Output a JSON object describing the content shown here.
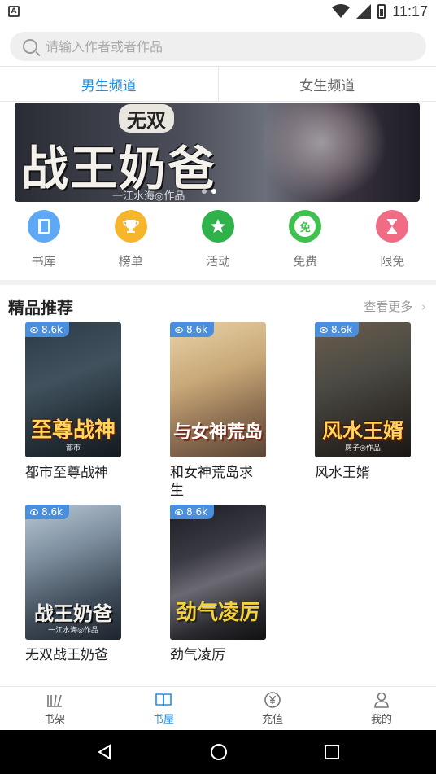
{
  "status_bar": {
    "time": "11:17"
  },
  "search": {
    "placeholder": "请输入作者或者作品"
  },
  "tabs": [
    {
      "label": "男生频道",
      "active": true
    },
    {
      "label": "女生频道",
      "active": false
    }
  ],
  "banner": {
    "top_text": "无双",
    "title": "战王奶爸",
    "subtitle": "一江水海◎作品"
  },
  "categories": [
    {
      "label": "书库",
      "icon": "book-icon",
      "color": "#5ea8f5"
    },
    {
      "label": "榜单",
      "icon": "trophy-icon",
      "color": "#f7b52c"
    },
    {
      "label": "活动",
      "icon": "star-icon",
      "color": "#2fb24a"
    },
    {
      "label": "免费",
      "icon": "free-badge-icon",
      "color": "#3fc04f"
    },
    {
      "label": "限免",
      "icon": "hourglass-icon",
      "color": "#f06b84"
    }
  ],
  "free_badge_glyph": "免",
  "section": {
    "title": "精品推荐",
    "more": "查看更多"
  },
  "books": [
    {
      "title": "都市至尊战神",
      "views": "8.6k",
      "cover_text": "至尊战神",
      "cover_author": "都市"
    },
    {
      "title": "和女神荒岛求生",
      "views": "8.6k",
      "cover_text": "与女神荒岛",
      "cover_author": ""
    },
    {
      "title": "风水王婿",
      "views": "8.6k",
      "cover_text": "风水王婿",
      "cover_author": "房子◎作品"
    },
    {
      "title": "无双战王奶爸",
      "views": "8.6k",
      "cover_text": "战王奶爸",
      "cover_author": "一江水海◎作品"
    },
    {
      "title": "劲气凌厉",
      "views": "8.6k",
      "cover_text": "劲气凌厉",
      "cover_author": ""
    }
  ],
  "bottom_nav": [
    {
      "label": "书架",
      "icon": "bookshelf-icon",
      "active": false
    },
    {
      "label": "书屋",
      "icon": "open-book-icon",
      "active": true
    },
    {
      "label": "充值",
      "icon": "yen-icon",
      "active": false
    },
    {
      "label": "我的",
      "icon": "person-icon",
      "active": false
    }
  ],
  "colors": {
    "accent": "#1e90e8",
    "badge": "#4a8fdf"
  }
}
